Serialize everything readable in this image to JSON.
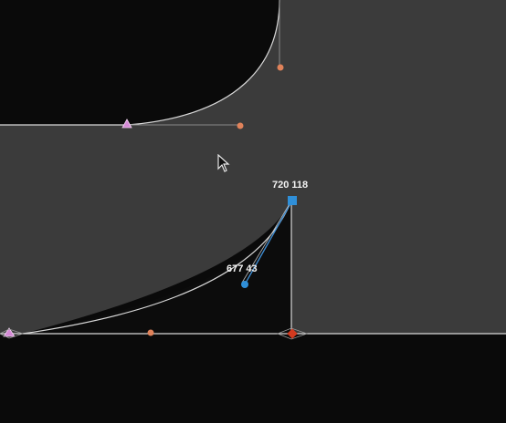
{
  "editor": {
    "background_color": "#0a0a0a",
    "glyph_fill_color": "#3b3b3b",
    "outline_color": "#d9d9d9",
    "handle_line_color": "#8a8a8a",
    "selected_handle_line_color": "#3f8fd6"
  },
  "selected_point": {
    "coordinate_label": "720 118",
    "color": "#2f8fd8",
    "icon": "square-on-curve-node-icon"
  },
  "selected_handle": {
    "coordinate_label": "677 43",
    "color": "#2f8fd8",
    "icon": "circle-offcurve-handle-icon"
  },
  "nodes": {
    "start_node_icon": "pink-triangle-start-node-icon",
    "start_node_color": "#d58ad6",
    "offcurve_handle_color": "#e0825a",
    "corner_node_color": "#d23a1f"
  },
  "cursor": {
    "icon": "arrow-pointer-icon"
  }
}
